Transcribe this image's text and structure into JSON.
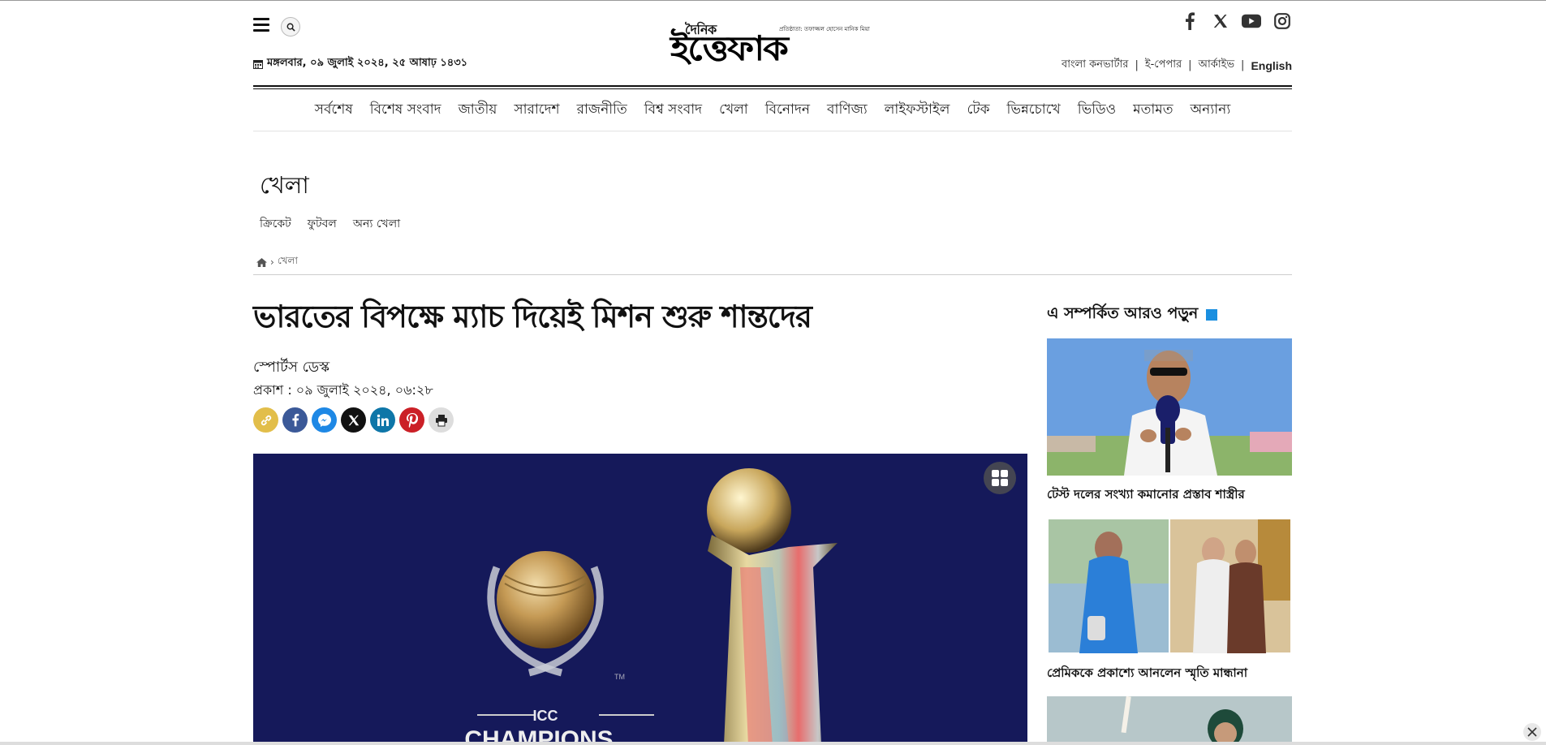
{
  "header": {
    "date": "মঙ্গলবার, ০৯ জুলাই ২০২৪, ২৫ আষাঢ় ১৪৩১",
    "logo_small": "দৈনিক",
    "logo_main": "ইত্তেফাক",
    "logo_tagline": "প্রতিষ্ঠাতা: তফাজ্জল হোসেন মানিক মিয়া",
    "top_links": [
      "বাংলা কনভার্টার",
      "ই-পেপার",
      "আর্কাইভ",
      "English"
    ],
    "social_icons": [
      "facebook-icon",
      "x-icon",
      "youtube-icon",
      "instagram-icon"
    ]
  },
  "nav": {
    "items": [
      "সর্বশেষ",
      "বিশেষ সংবাদ",
      "জাতীয়",
      "সারাদেশ",
      "রাজনীতি",
      "বিশ্ব সংবাদ",
      "খেলা",
      "বিনোদন",
      "বাণিজ্য",
      "লাইফস্টাইল",
      "টেক",
      "ভিন্নচোখে",
      "ভিডিও",
      "মতামত",
      "অন্যান্য"
    ]
  },
  "category": {
    "title": "খেলা",
    "subnav": [
      "ক্রিকেট",
      "ফুটবল",
      "অন্য খেলা"
    ],
    "breadcrumb": "খেলা"
  },
  "article": {
    "headline": "ভারতের বিপক্ষে ম্যাচ দিয়েই মিশন শুরু শান্তদের",
    "author": "স্পোর্টস ডেস্ক",
    "published": "প্রকাশ : ০৯ জুলাই ২০২৪, ০৬:২৮",
    "image_caption_text": "ICC",
    "image_caption_text2": "CHAMPIONS",
    "image_tm": "TM"
  },
  "related": {
    "title": "এ সম্পর্কিত আরও পড়ুন",
    "items": [
      {
        "caption": "টেস্ট দলের সংখ্যা কমানোর প্রস্তাব শাস্ত্রীর"
      },
      {
        "caption": "প্রেমিককে প্রকাশ্যে আনলেন স্মৃতি মান্ধানা"
      },
      {
        "caption": ""
      }
    ]
  },
  "colors": {
    "accent": "#1a8fe0",
    "hero_bg": "#15195a"
  }
}
